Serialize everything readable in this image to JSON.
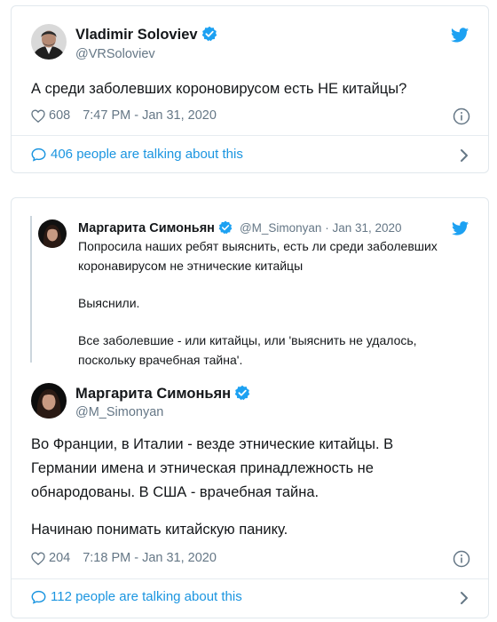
{
  "tweet1": {
    "name": "Vladimir Soloviev",
    "handle": "@VRSoloviev",
    "text": "А среди заболевших короновирусом есть НЕ китайцы?",
    "likes": "608",
    "time": "7:47 PM - Jan 31, 2020",
    "talking": "406 people are talking about this"
  },
  "tweet2": {
    "quoted": {
      "name": "Маргарита Симоньян",
      "handle": "@M_Simonyan · Jan 31, 2020",
      "lines": [
        "Попросила наших ребят выяснить, есть ли среди заболевших",
        "коронавирусом не этнические китайцы",
        "Выяснили.",
        "Все заболевшие - или китайцы, или 'выяснить не удалось,",
        "поскольку врачебная тайна'."
      ]
    },
    "name": "Маргарита Симоньян",
    "handle": "@M_Simonyan",
    "lines": [
      "Во Франции, в Италии - везде этнические китайцы. В",
      "Германии имена и этническая принадлежность не",
      "обнародованы. В США - врачебная тайна.",
      "Начинаю понимать китайскую панику."
    ],
    "likes": "204",
    "time": "7:18 PM - Jan 31, 2020",
    "talking": "112 people are talking about this"
  },
  "colors": {
    "twitter_blue": "#1da1f2",
    "link_blue": "#1b95e0",
    "secondary_text": "#657786",
    "border": "#e1e8ed"
  },
  "icons": [
    "twitter-bird-icon",
    "verified-badge-icon",
    "heart-icon",
    "info-icon",
    "speech-bubble-icon",
    "chevron-right-icon"
  ]
}
